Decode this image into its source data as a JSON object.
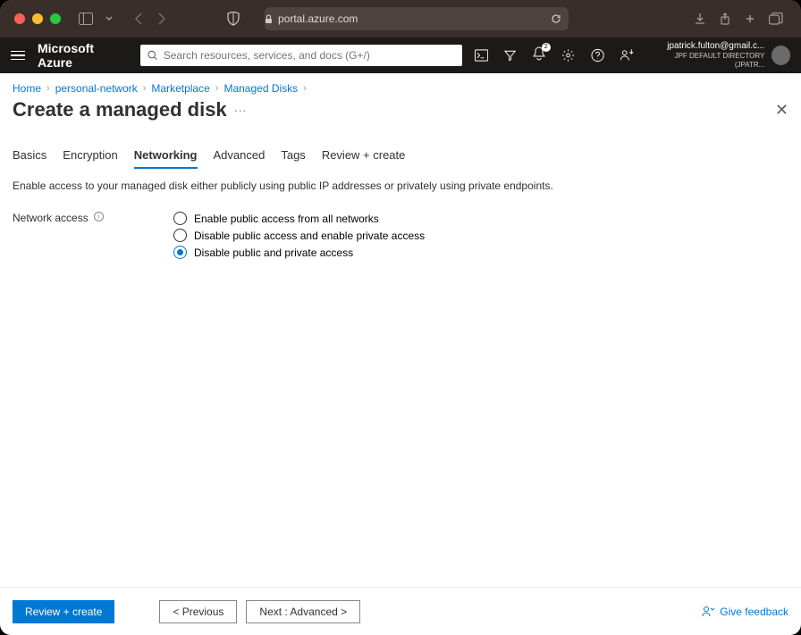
{
  "browser": {
    "url": "portal.azure.com"
  },
  "header": {
    "brand": "Microsoft Azure",
    "search_placeholder": "Search resources, services, and docs (G+/)",
    "notification_count": "2",
    "account_email": "jpatrick.fulton@gmail.c...",
    "account_directory": "JPF DEFAULT DIRECTORY (JPATR..."
  },
  "breadcrumb": {
    "items": [
      "Home",
      "personal-network",
      "Marketplace",
      "Managed Disks"
    ]
  },
  "page": {
    "title": "Create a managed disk"
  },
  "tabs": {
    "items": [
      "Basics",
      "Encryption",
      "Networking",
      "Advanced",
      "Tags",
      "Review + create"
    ],
    "active_index": 2
  },
  "form": {
    "description": "Enable access to your managed disk either publicly using public IP addresses or privately using private endpoints.",
    "network_access_label": "Network access",
    "options": [
      "Enable public access from all networks",
      "Disable public access and enable private access",
      "Disable public and private access"
    ],
    "selected_option_index": 2
  },
  "footer": {
    "primary": "Review + create",
    "prev": "<  Previous",
    "next": "Next : Advanced  >",
    "feedback": "Give feedback"
  }
}
